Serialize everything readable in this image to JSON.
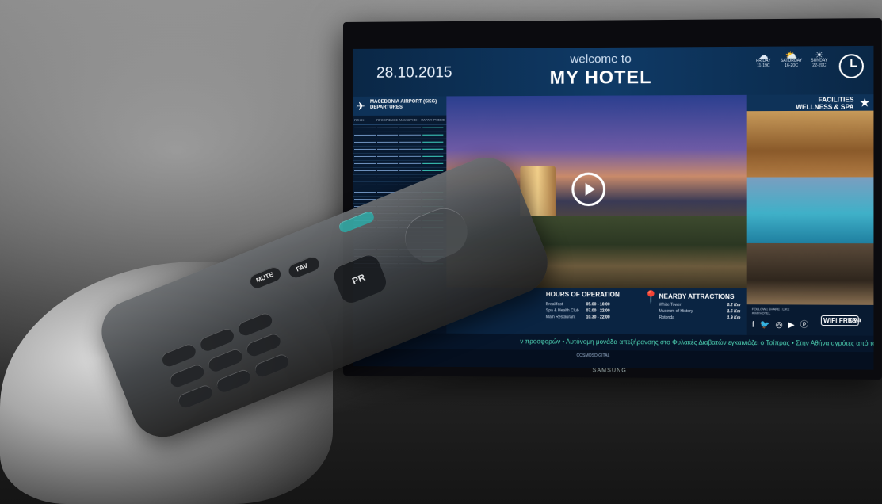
{
  "screen": {
    "date": "28.10.2015",
    "welcome": "welcome to",
    "hotel": "MY HOTEL",
    "weather": [
      {
        "day": "FRIDAY",
        "temp": "11-19C",
        "icon": "cloud-rain-icon"
      },
      {
        "day": "SATURDAY",
        "temp": "16-20C",
        "icon": "cloud-sun-icon"
      },
      {
        "day": "SUNDAY",
        "temp": "22-20C",
        "icon": "sun-icon"
      }
    ],
    "flights": {
      "title": "MACEDONIA AIRPORT (SKG)",
      "subtitle": "DEPARTURES",
      "columns": [
        "ΠΤΗΣΗ",
        "ΠΡΟΟΡΙΣΜΟΣ",
        "ΑΝΑΧΩΡΗΣΗ",
        "ΠΑΡΑΤΗΡΗΣΕΙΣ"
      ]
    },
    "facilities": {
      "line1": "FACILITIES",
      "line2": "WELLNESS & SPA"
    },
    "hours": {
      "title": "HOURS OF OPERATION",
      "rows": [
        {
          "name": "Breakfast",
          "time": "05.00 - 10.00"
        },
        {
          "name": "Spa & Health Club",
          "time": "07.00 - 22.00"
        },
        {
          "name": "Main Restaurant",
          "time": "10.30 - 22.00"
        }
      ]
    },
    "attractions": {
      "title": "NEARBY ATTRACTIONS",
      "rows": [
        {
          "name": "White Tower",
          "dist": "0.2 Km"
        },
        {
          "name": "Museum of History",
          "dist": "1.6 Km"
        },
        {
          "name": "Rotonda",
          "dist": "1.9 Km"
        }
      ]
    },
    "social": {
      "follow": "FOLLOW | SHARE | LIKE",
      "tag": "# MYHOTEL",
      "icons": "f 🐦 ◎ ▶ ⓟ",
      "wifi": "WiFi",
      "wifi_free": "FREE",
      "nova": "nova"
    },
    "ticker": "ν προσφορών  •  Αυτόνομη μονάδα απεξήρανσης στο Φυλακές Διαβατών εγκαινιάζει ο Τσίπρας  •  Στην Αθήνα αγρότες από το μπ",
    "cosmos": "COSMOSDIGITAL",
    "brand": "SAMSUNG"
  },
  "remote": {
    "mute": "MUTE",
    "fav": "FAV",
    "pr": "PR"
  }
}
